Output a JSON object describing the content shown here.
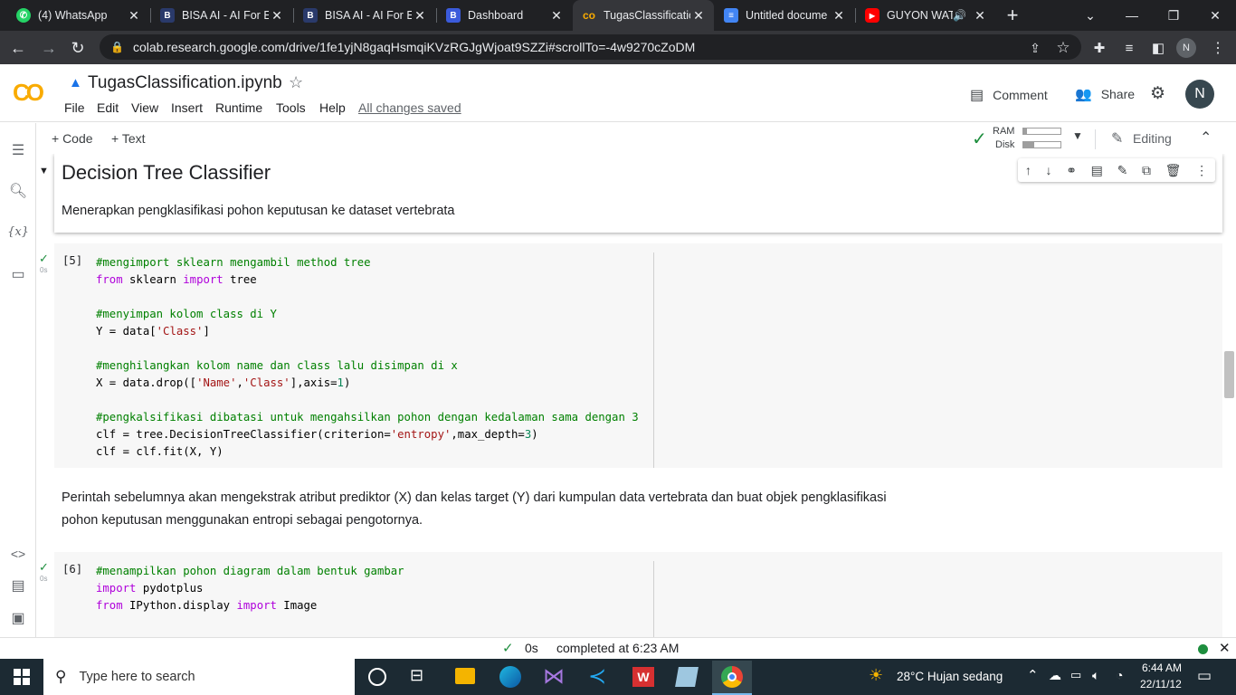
{
  "browser": {
    "tabs": [
      {
        "title": "(4) WhatsApp",
        "icon": "whatsapp-icon",
        "color": "#25d366"
      },
      {
        "title": "BISA AI - AI For E",
        "icon": "bisa-ai-icon",
        "color": "#3b5bdb"
      },
      {
        "title": "BISA AI - AI For E",
        "icon": "bisa-ai-icon",
        "color": "#3b5bdb"
      },
      {
        "title": "Dashboard",
        "icon": "dashboard-icon",
        "color": "#3b5bdb"
      },
      {
        "title": "TugasClassificatio",
        "icon": "colab-icon",
        "color": "#f9ab00"
      },
      {
        "title": "Untitled docume",
        "icon": "google-docs-icon",
        "color": "#4285f4"
      },
      {
        "title": "GUYON WAT",
        "icon": "youtube-icon",
        "color": "#ff0000"
      }
    ],
    "url": "colab.research.google.com/drive/1fe1yjN8gaqHsmqiKVzRGJgWjoat9SZZi#scrollTo=-4w9270cZoDM",
    "profile_initial": "N"
  },
  "colab": {
    "logo": "CO",
    "notebook_title": "TugasClassification.ipynb",
    "menus": [
      "File",
      "Edit",
      "View",
      "Insert",
      "Runtime",
      "Tools",
      "Help"
    ],
    "saved_status": "All changes saved",
    "comment_label": "Comment",
    "share_label": "Share",
    "avatar": "N",
    "add_code": "+ Code",
    "add_text": "+ Text",
    "ram_label": "RAM",
    "disk_label": "Disk",
    "editing_label": "Editing"
  },
  "notebook": {
    "section_title": "Decision Tree Classifier",
    "section_desc": "Menerapkan pengklasifikasi pohon keputusan ke dataset vertebrata",
    "cell5": {
      "exec_count": "[5]",
      "time": "0s"
    },
    "text_between": "Perintah sebelumnya akan mengekstrak atribut prediktor (X) dan kelas target (Y) dari kumpulan data vertebrata dan buat objek pengklasifikasi",
    "text_between_2": "pohon keputusan menggunakan entropi sebagai pengotornya.",
    "cell6": {
      "exec_count": "[6]",
      "time": "0s"
    }
  },
  "status": {
    "check": "✓",
    "elapsed": "0s",
    "completed": "completed at 6:23 AM"
  },
  "taskbar": {
    "search_placeholder": "Type here to search",
    "weather": "28°C  Hujan sedang",
    "time": "6:44 AM",
    "date": "22/11/12"
  }
}
